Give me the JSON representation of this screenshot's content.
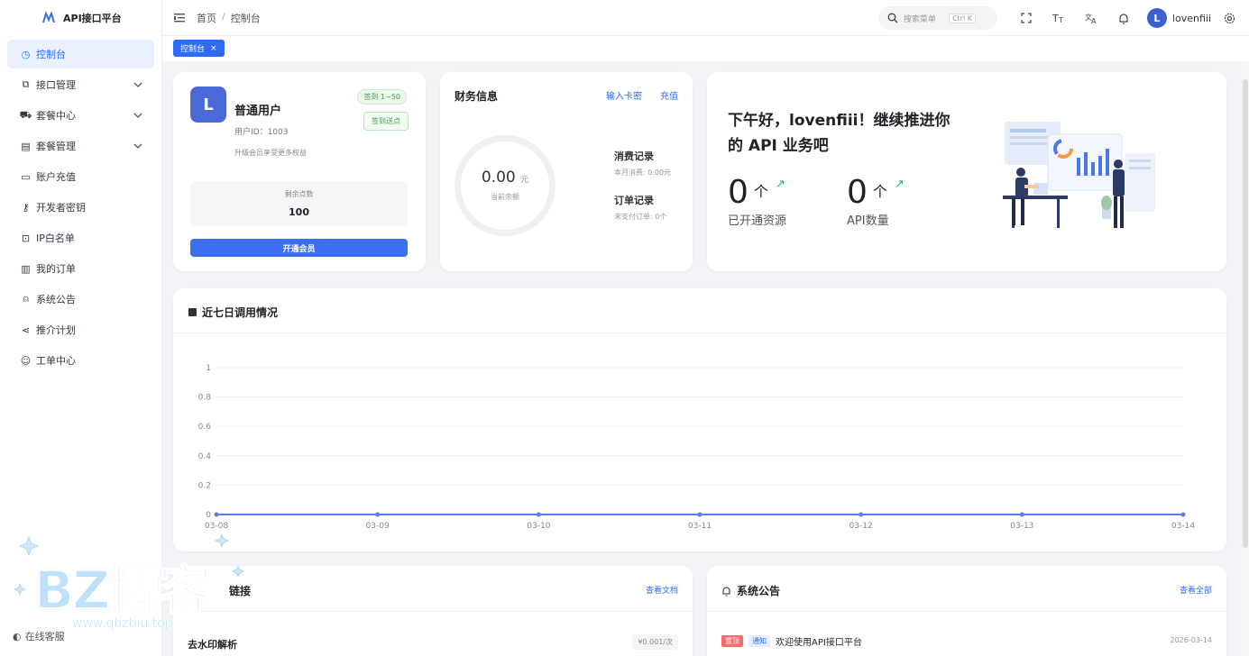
{
  "brand": {
    "title": "API接口平台"
  },
  "sidebar": {
    "items": [
      {
        "label": "控制台",
        "icon": "dashboard-icon",
        "active": true,
        "expandable": false
      },
      {
        "label": "接口管理",
        "icon": "link-icon",
        "active": false,
        "expandable": true
      },
      {
        "label": "套餐中心",
        "icon": "cart-icon",
        "active": false,
        "expandable": true
      },
      {
        "label": "套餐管理",
        "icon": "doc-icon",
        "active": false,
        "expandable": true
      },
      {
        "label": "账户充值",
        "icon": "folder-icon",
        "active": false,
        "expandable": false
      },
      {
        "label": "开发者密钥",
        "icon": "key-icon",
        "active": false,
        "expandable": false
      },
      {
        "label": "IP白名单",
        "icon": "lock-icon",
        "active": false,
        "expandable": false
      },
      {
        "label": "我的订单",
        "icon": "order-icon",
        "active": false,
        "expandable": false
      },
      {
        "label": "系统公告",
        "icon": "bell-icon",
        "active": false,
        "expandable": false
      },
      {
        "label": "推介计划",
        "icon": "share-icon",
        "active": false,
        "expandable": false
      },
      {
        "label": "工单中心",
        "icon": "ticket-icon",
        "active": false,
        "expandable": false
      }
    ],
    "bottom": {
      "label": "在线客服"
    }
  },
  "header": {
    "breadcrumb": [
      "首页",
      "控制台"
    ],
    "search_placeholder": "搜索菜单",
    "search_shortcut": "Ctrl K",
    "user_initial": "L",
    "user_name": "lovenfiii"
  },
  "tabs": [
    {
      "label": "控制台"
    }
  ],
  "user_card": {
    "initial": "L",
    "name": "普通用户",
    "user_id": "用户ID：1003",
    "hint": "升级会员享受更多权益",
    "checkin_range": "签到 1~50",
    "checkin_button": "签到送点",
    "points_label": "剩余点数",
    "points_value": "100",
    "member_button": "开通会员"
  },
  "finance": {
    "title": "财务信息",
    "link_card": "输入卡密",
    "link_recharge": "充值",
    "balance": "0.00",
    "balance_unit": "元",
    "balance_label": "当前余额",
    "consume_title": "消费记录",
    "consume_sub": "本月消费: 0.00元",
    "order_title": "订单记录",
    "order_sub": "未支付订单: 0个"
  },
  "welcome": {
    "greeting": "下午好，lovenfiii！继续推进你的 API 业务吧",
    "stats": [
      {
        "value": "0",
        "unit": "个",
        "label": "已开通资源"
      },
      {
        "value": "0",
        "unit": "个",
        "label": "API数量"
      }
    ]
  },
  "chart_card": {
    "title": "近七日调用情况"
  },
  "chart_data": {
    "type": "line",
    "categories": [
      "03-08",
      "03-09",
      "03-10",
      "03-11",
      "03-12",
      "03-13",
      "03-14"
    ],
    "series": [
      {
        "values": [
          0,
          0,
          0,
          0,
          0,
          0,
          0
        ]
      }
    ],
    "y_ticks": [
      "0",
      "0.2",
      "0.4",
      "0.6",
      "0.8",
      "1"
    ],
    "ylim": [
      0,
      1
    ],
    "grid": true,
    "color": "#5b7be6"
  },
  "docs_card": {
    "title": "链接",
    "link": "查看文档",
    "api_name": "去水印解析",
    "api_price": "¥0.001/次"
  },
  "notice_card": {
    "title": "系统公告",
    "link": "查看全部",
    "tag_top": "置顶",
    "tag_type": "通知",
    "notice_title": "欢迎使用API接口平台",
    "notice_date": "2026-03-14"
  },
  "watermark": {
    "title": "BZ博客",
    "url": "www.qbzbiu.top"
  }
}
